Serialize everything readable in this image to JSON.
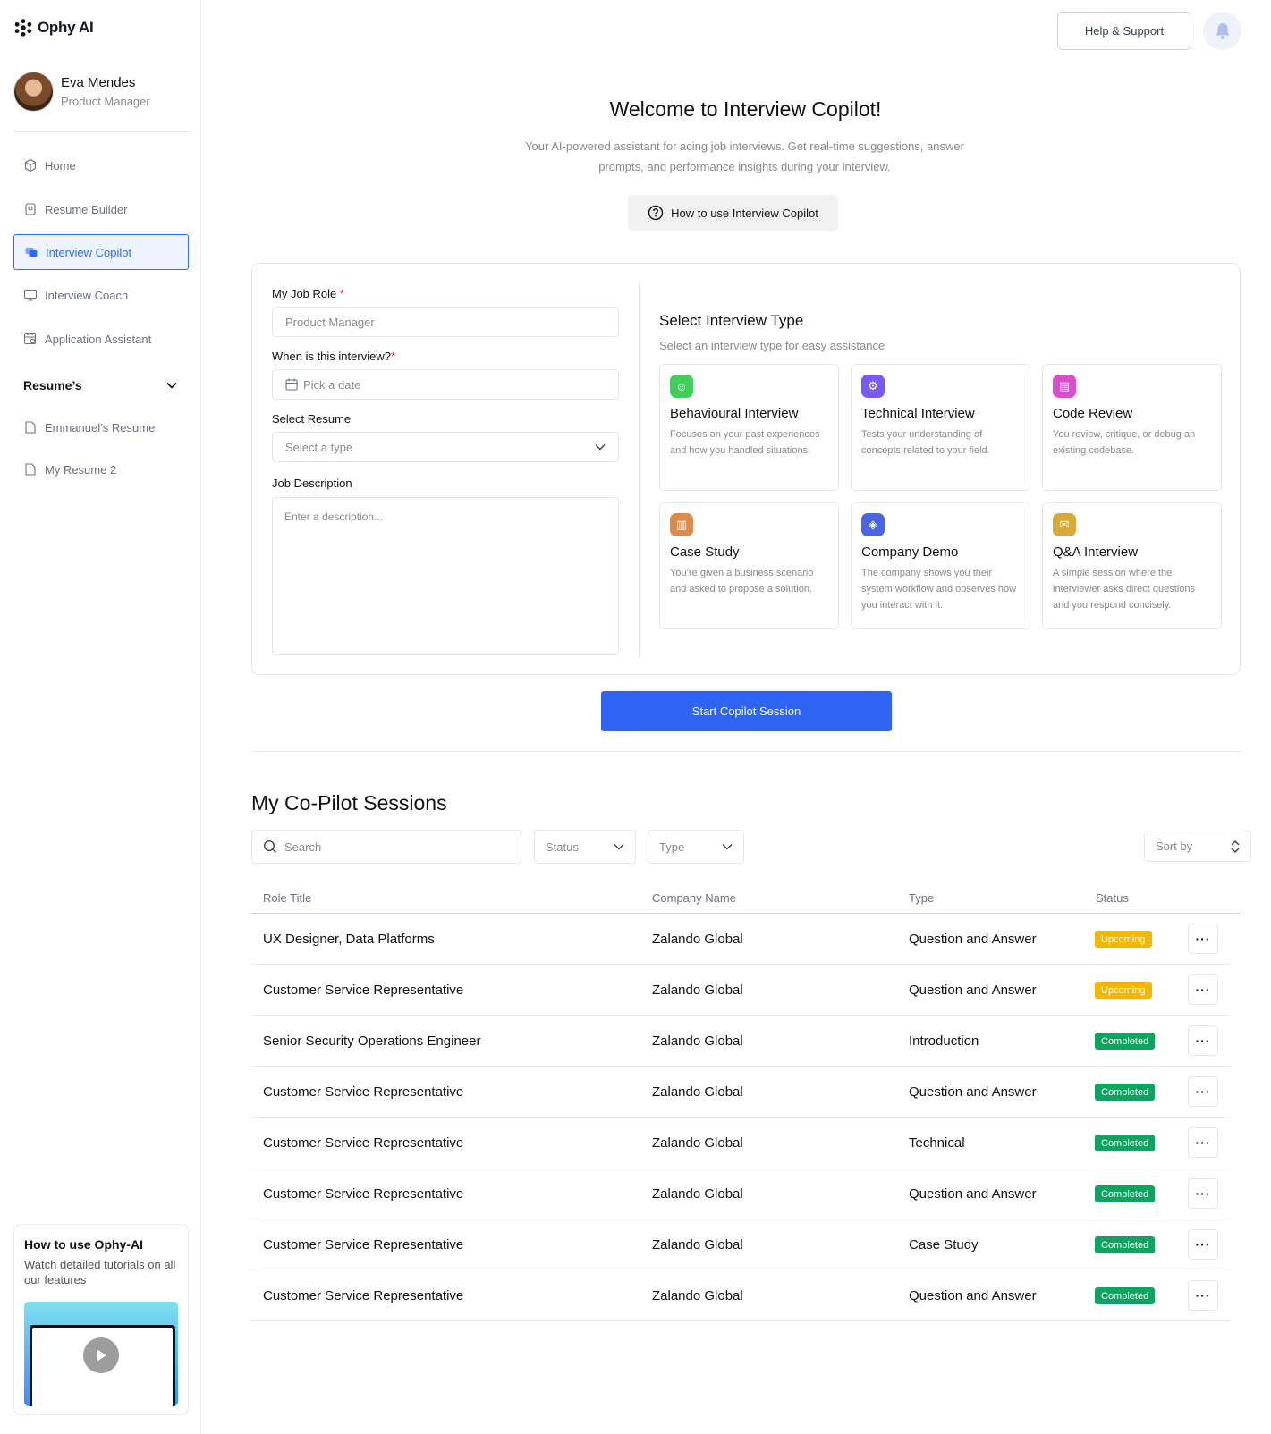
{
  "brand": {
    "name": "Ophy AI"
  },
  "profile": {
    "name": "Eva Mendes",
    "role": "Product Manager"
  },
  "nav": [
    {
      "label": "Home",
      "icon": "cube-icon"
    },
    {
      "label": "Resume Builder",
      "icon": "resume-icon"
    },
    {
      "label": "Interview Copilot",
      "icon": "copilot-icon",
      "active": true
    },
    {
      "label": "Interview Coach",
      "icon": "monitor-icon"
    },
    {
      "label": "Application Assistant",
      "icon": "calendar-settings-icon"
    }
  ],
  "resumes": {
    "heading": "Resume’s",
    "items": [
      "Emmanuel’s Resume",
      "My Resume 2"
    ]
  },
  "tutorial": {
    "title": "How to use Ophy-AI",
    "description": "Watch detailed tutorials on all our features"
  },
  "topbar": {
    "help_label": "Help & Support"
  },
  "hero": {
    "title": "Welcome to Interview Copilot!",
    "subtitle": "Your AI-powered assistant for acing job interviews. Get real-time suggestions, answer prompts, and performance insights during your interview.",
    "howto_label": "How to use Interview Copilot"
  },
  "form": {
    "job_role_label": "My Job Role",
    "job_role_placeholder": "Product Manager",
    "date_label": "When is this interview?",
    "date_placeholder": "Pick a date",
    "resume_label": "Select Resume",
    "resume_placeholder": "Select a type",
    "description_label": "Job Description",
    "description_placeholder": "Enter a description...",
    "required_mark": "*"
  },
  "interview_types": {
    "title": "Select Interview Type",
    "subtitle": "Select an interview type for easy assistance",
    "items": [
      {
        "name": "Behavioural Interview",
        "desc": "Focuses on your past experiences and how you handled situations.",
        "icon": "behavioural-icon",
        "color": "#3fcf5a"
      },
      {
        "name": "Technical Interview",
        "desc": "Tests your understanding of concepts related to your field.",
        "icon": "technical-icon",
        "color": "#7a5af5"
      },
      {
        "name": "Code Review",
        "desc": "You review, critique, or debug an existing codebase.",
        "icon": "code-review-icon",
        "color": "#d94ec9"
      },
      {
        "name": "Case Study",
        "desc": "You’re given a business scenario and asked to propose a solution.",
        "icon": "case-study-icon",
        "color": "#e08a4a"
      },
      {
        "name": "Company Demo",
        "desc": "The company shows you their system workflow and observes how you  interact with it.",
        "icon": "company-demo-icon",
        "color": "#4a67e0"
      },
      {
        "name": "Q&A Interview",
        "desc": "A simple session where the interviewer asks direct questions and you respond concisely.",
        "icon": "qa-icon",
        "color": "#d9a93a"
      }
    ]
  },
  "start_label": "Start Copilot Session",
  "sessions": {
    "title": "My Co-Pilot Sessions",
    "search_placeholder": "Search",
    "status_filter": "Status",
    "type_filter": "Type",
    "sort_label": "Sort by",
    "columns": [
      "Role Title",
      "Company Name",
      "Type",
      "Status"
    ],
    "rows": [
      {
        "role": "UX Designer, Data Platforms",
        "company": "Zalando Global",
        "type": "Question and Answer",
        "status": "Upcoming"
      },
      {
        "role": "Customer Service Representative",
        "company": "Zalando Global",
        "type": "Question and Answer",
        "status": "Upcoming"
      },
      {
        "role": "Senior Security Operations Engineer",
        "company": "Zalando Global",
        "type": "Introduction",
        "status": "Completed"
      },
      {
        "role": "Customer Service Representative",
        "company": "Zalando Global",
        "type": "Question and Answer",
        "status": "Completed"
      },
      {
        "role": "Customer Service Representative",
        "company": "Zalando Global",
        "type": "Technical",
        "status": "Completed"
      },
      {
        "role": "Customer Service Representative",
        "company": "Zalando Global",
        "type": "Question and Answer",
        "status": "Completed"
      },
      {
        "role": "Customer Service Representative",
        "company": "Zalando Global",
        "type": "Case Study",
        "status": "Completed"
      },
      {
        "role": "Customer Service Representative",
        "company": "Zalando Global",
        "type": "Question and Answer",
        "status": "Completed"
      }
    ],
    "more_label": "···"
  },
  "colors": {
    "accent": "#2f63f1",
    "upcoming": "#f2b705",
    "completed": "#10a360"
  }
}
